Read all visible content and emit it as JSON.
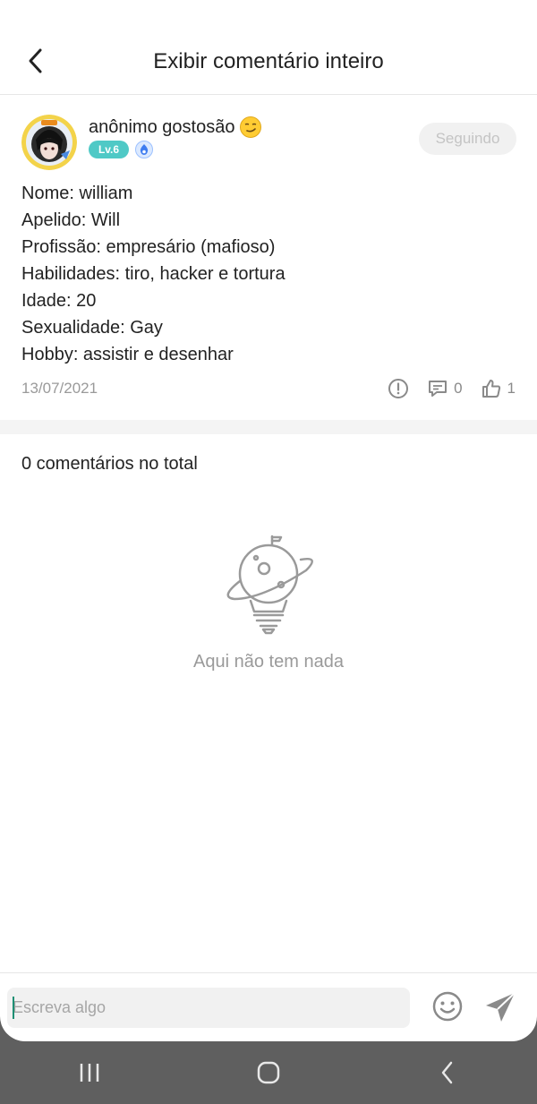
{
  "header": {
    "title": "Exibir comentário inteiro",
    "back_icon": "chevron-left-icon"
  },
  "post": {
    "author": "anônimo gostosão",
    "emoji": "😏",
    "level": "Lv.6",
    "follow_label": "Seguindo",
    "lines": [
      "Nome: william",
      "Apelido: Will",
      "Profissão: empresário (mafioso)",
      "Habilidades: tiro, hacker e tortura",
      "Idade: 20",
      "Sexualidade: Gay",
      "Hobby: assistir e desenhar"
    ],
    "date": "13/07/2021",
    "comment_count": "0",
    "like_count": "1"
  },
  "comments": {
    "total_label": "0 comentários no total",
    "empty_text": "Aqui não tem nada"
  },
  "composer": {
    "placeholder": "Escreva algo"
  },
  "colors": {
    "accent": "#4fc9c6",
    "muted": "#9a9a9a",
    "nav_bg": "#5f5f5f"
  }
}
